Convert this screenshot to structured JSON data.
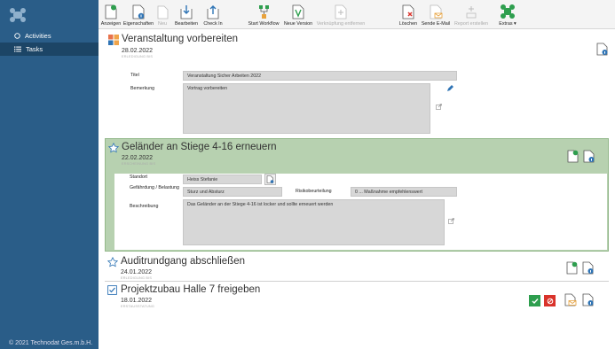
{
  "app": {
    "footer": "© 2021 Technodat Ges.m.b.H."
  },
  "sidebar": {
    "items": [
      {
        "label": "Activities",
        "active": false
      },
      {
        "label": "Tasks",
        "active": true
      }
    ]
  },
  "toolbar": {
    "anzeigen": "Anzeigen",
    "eigenschaften": "Eigenschaften",
    "neu": "Neu",
    "bearbeiten": "Bearbeiten",
    "check_in": "Check In",
    "start_workflow": "Start Workflow",
    "neue_version": "Neue Version",
    "verknuepfung_entfernen": "Verknüpfung entfernen",
    "loeschen": "Löschen",
    "sende_email": "Sende E-Mail",
    "report_erstellen": "Report erstellen",
    "extras": "Extras ▾"
  },
  "cards": [
    {
      "title": "Veranstaltung vorbereiten",
      "date": "28.02.2022",
      "subtitle": "ERLEDIGUNG BIS",
      "fields": [
        {
          "label": "Titel",
          "value": "Veranstaltung Sicher Arbeiten 2022"
        },
        {
          "label": "Bemerkung",
          "value": "Vortrag vorbereiten"
        }
      ]
    },
    {
      "title": "Geländer an Stiege 4-16 erneuern",
      "date": "22.02.2022",
      "subtitle": "ERSCHEINUNG BIS",
      "fields": [
        {
          "label": "Standort",
          "value": "Heiss Stefanie"
        },
        {
          "label": "Gefährdung / Belastung",
          "value": "Sturz und Absturz"
        },
        {
          "label": "Risikobeurteilung",
          "value": "0 ... Maßnahme empfehlenswert"
        },
        {
          "label": "Beschreibung",
          "value": "Das Geländer an der Stiege 4-16 ist locker und sollte erneuert werden"
        }
      ]
    },
    {
      "title": "Auditrundgang abschließen",
      "date": "24.01.2022",
      "subtitle": "ERLEDIGUNG BIS"
    },
    {
      "title": "Projektzubau Halle 7 freigeben",
      "date": "18.01.2022",
      "subtitle": "ERSTAUSSTATUNG"
    }
  ],
  "colors": {
    "sidebar": "#2a5d88",
    "highlight": "#b7d1b0",
    "accept": "#2e9e4e",
    "reject": "#d9332b",
    "info": "#2f74b5"
  }
}
